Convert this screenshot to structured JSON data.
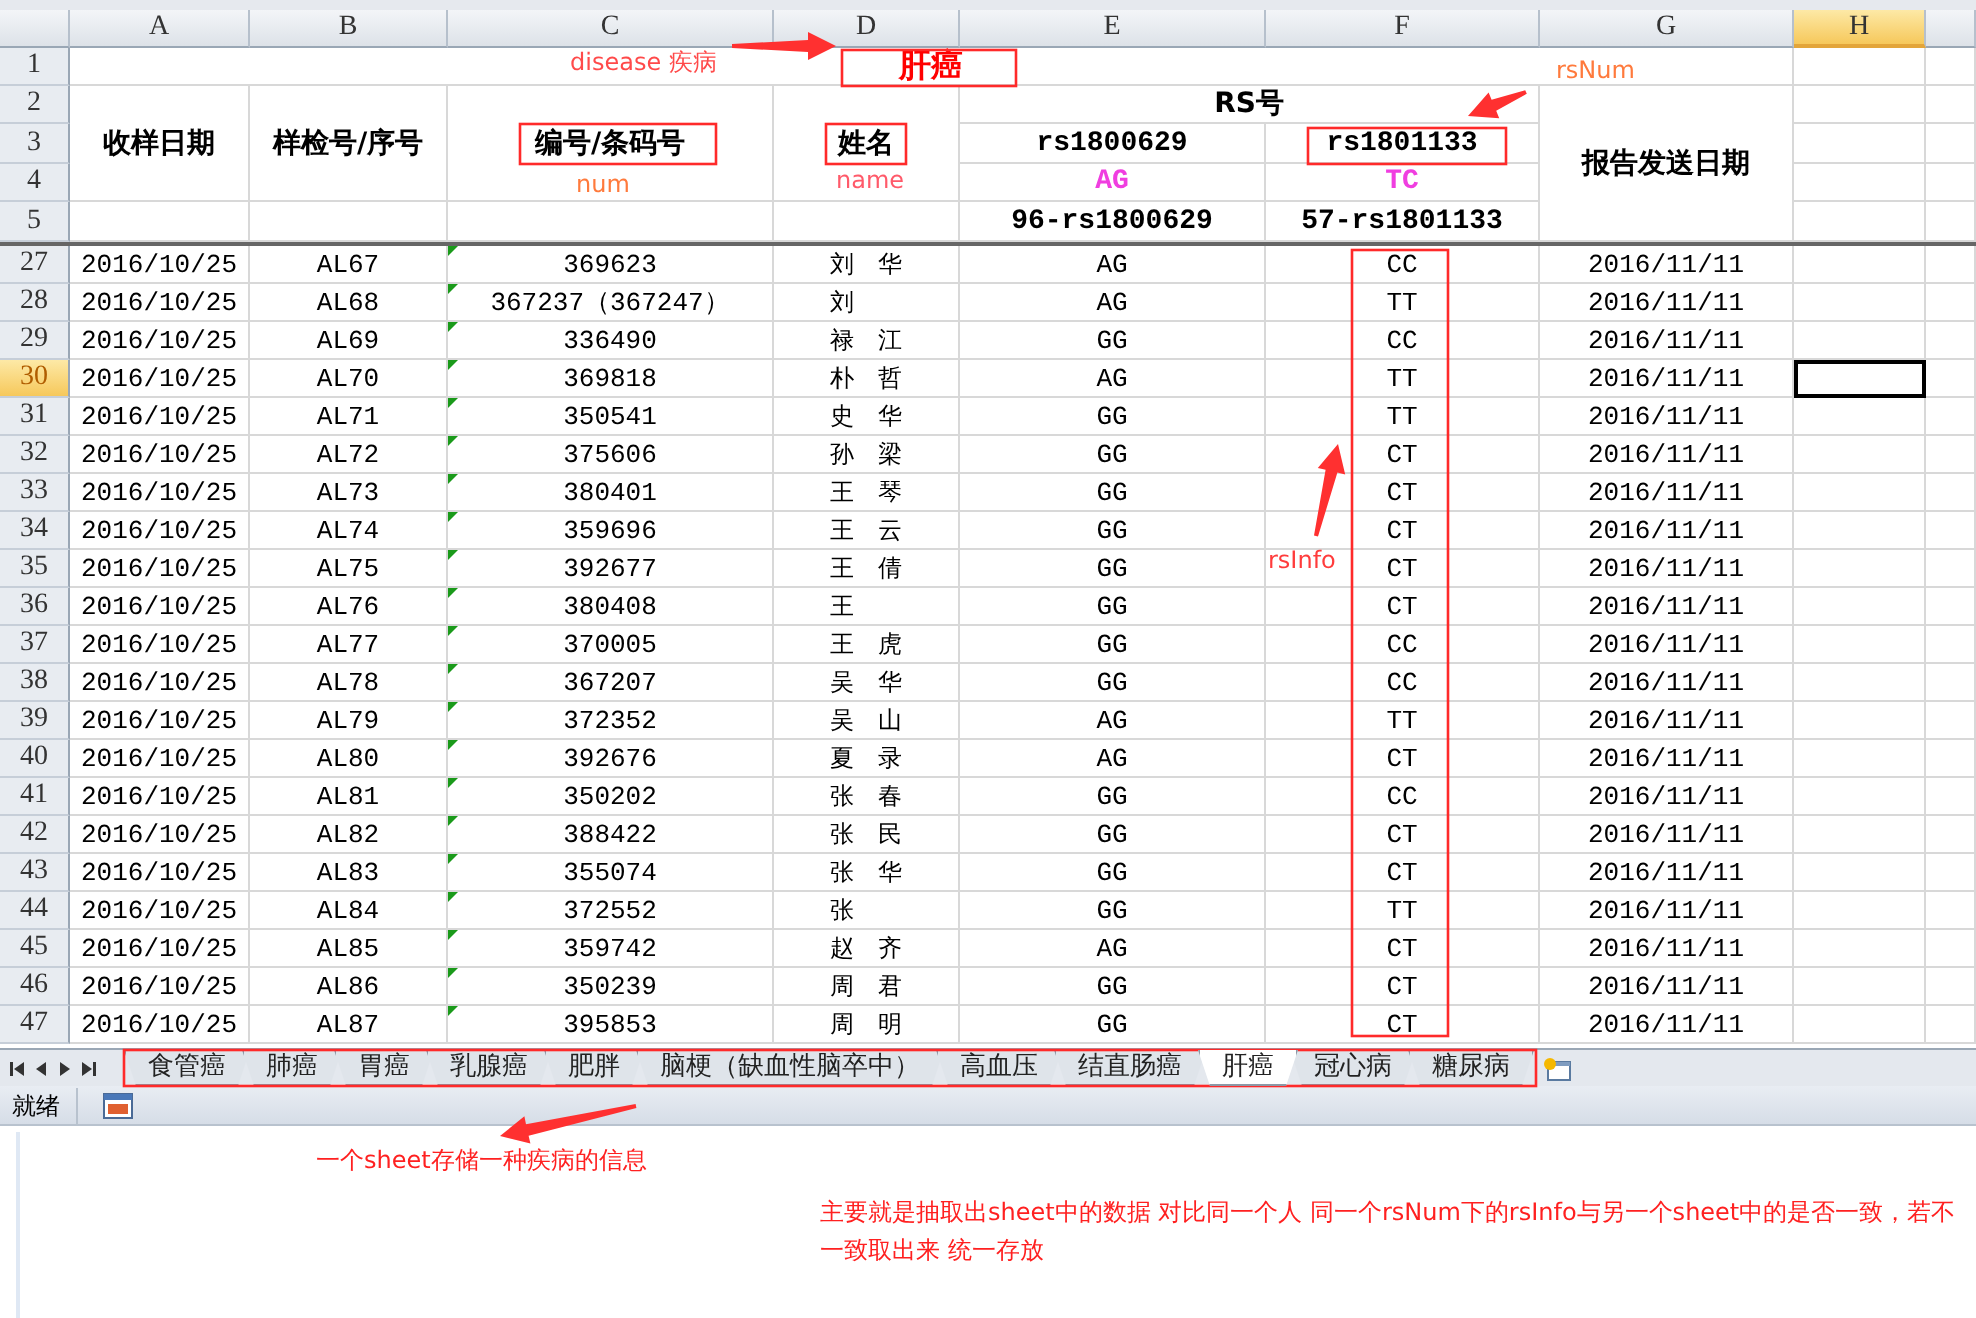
{
  "columns": [
    {
      "label": "A",
      "selected": false
    },
    {
      "label": "B",
      "selected": false
    },
    {
      "label": "C",
      "selected": false
    },
    {
      "label": "D",
      "selected": false
    },
    {
      "label": "E",
      "selected": false
    },
    {
      "label": "F",
      "selected": false
    },
    {
      "label": "G",
      "selected": false
    },
    {
      "label": "H",
      "selected": true
    }
  ],
  "header_rows": [
    "1",
    "2",
    "3",
    "4",
    "5"
  ],
  "header": {
    "disease": "肝癌",
    "date": "收样日期",
    "sample": "样检号/序号",
    "num": "编号/条码号",
    "name": "姓名",
    "rs": "RS号",
    "report": "报告发送日期",
    "snps": [
      {
        "id": "rs1800629",
        "allele": "AG",
        "code": "96-rs1800629"
      },
      {
        "id": "rs1801133",
        "allele": "TC",
        "code": "57-rs1801133"
      }
    ]
  },
  "rows": [
    {
      "number": "27",
      "selected": false,
      "cells": [
        "2016/10/25",
        "AL67",
        "369623",
        "刘　华",
        "AG",
        "CC",
        "2016/11/11"
      ]
    },
    {
      "number": "28",
      "selected": false,
      "cells": [
        "2016/10/25",
        "AL68",
        "367237（367247）",
        "刘",
        "AG",
        "TT",
        "2016/11/11"
      ]
    },
    {
      "number": "29",
      "selected": false,
      "cells": [
        "2016/10/25",
        "AL69",
        "336490",
        "禄　江",
        "GG",
        "CC",
        "2016/11/11"
      ]
    },
    {
      "number": "30",
      "selected": true,
      "cells": [
        "2016/10/25",
        "AL70",
        "369818",
        "朴　哲",
        "AG",
        "TT",
        "2016/11/11"
      ]
    },
    {
      "number": "31",
      "selected": false,
      "cells": [
        "2016/10/25",
        "AL71",
        "350541",
        "史　华",
        "GG",
        "TT",
        "2016/11/11"
      ]
    },
    {
      "number": "32",
      "selected": false,
      "cells": [
        "2016/10/25",
        "AL72",
        "375606",
        "孙　梁",
        "GG",
        "CT",
        "2016/11/11"
      ]
    },
    {
      "number": "33",
      "selected": false,
      "cells": [
        "2016/10/25",
        "AL73",
        "380401",
        "王　琴",
        "GG",
        "CT",
        "2016/11/11"
      ]
    },
    {
      "number": "34",
      "selected": false,
      "cells": [
        "2016/10/25",
        "AL74",
        "359696",
        "王　云",
        "GG",
        "CT",
        "2016/11/11"
      ]
    },
    {
      "number": "35",
      "selected": false,
      "cells": [
        "2016/10/25",
        "AL75",
        "392677",
        "王　倩",
        "GG",
        "CT",
        "2016/11/11"
      ]
    },
    {
      "number": "36",
      "selected": false,
      "cells": [
        "2016/10/25",
        "AL76",
        "380408",
        "王",
        "GG",
        "CT",
        "2016/11/11"
      ]
    },
    {
      "number": "37",
      "selected": false,
      "cells": [
        "2016/10/25",
        "AL77",
        "370005",
        "王　虎",
        "GG",
        "CC",
        "2016/11/11"
      ]
    },
    {
      "number": "38",
      "selected": false,
      "cells": [
        "2016/10/25",
        "AL78",
        "367207",
        "吴　华",
        "GG",
        "CC",
        "2016/11/11"
      ]
    },
    {
      "number": "39",
      "selected": false,
      "cells": [
        "2016/10/25",
        "AL79",
        "372352",
        "吴　山",
        "AG",
        "TT",
        "2016/11/11"
      ]
    },
    {
      "number": "40",
      "selected": false,
      "cells": [
        "2016/10/25",
        "AL80",
        "392676",
        "夏　录",
        "AG",
        "CT",
        "2016/11/11"
      ]
    },
    {
      "number": "41",
      "selected": false,
      "cells": [
        "2016/10/25",
        "AL81",
        "350202",
        "张　春",
        "GG",
        "CC",
        "2016/11/11"
      ]
    },
    {
      "number": "42",
      "selected": false,
      "cells": [
        "2016/10/25",
        "AL82",
        "388422",
        "张　民",
        "GG",
        "CT",
        "2016/11/11"
      ]
    },
    {
      "number": "43",
      "selected": false,
      "cells": [
        "2016/10/25",
        "AL83",
        "355074",
        "张　华",
        "GG",
        "CT",
        "2016/11/11"
      ]
    },
    {
      "number": "44",
      "selected": false,
      "cells": [
        "2016/10/25",
        "AL84",
        "372552",
        "张",
        "GG",
        "TT",
        "2016/11/11"
      ]
    },
    {
      "number": "45",
      "selected": false,
      "cells": [
        "2016/10/25",
        "AL85",
        "359742",
        "赵　齐",
        "AG",
        "CT",
        "2016/11/11"
      ]
    },
    {
      "number": "46",
      "selected": false,
      "cells": [
        "2016/10/25",
        "AL86",
        "350239",
        "周　君",
        "GG",
        "CT",
        "2016/11/11"
      ]
    },
    {
      "number": "47",
      "selected": false,
      "cells": [
        "2016/10/25",
        "AL87",
        "395853",
        "周　明",
        "GG",
        "CT",
        "2016/11/11"
      ]
    }
  ],
  "sheet_tabs": [
    {
      "label": "食管癌",
      "selected": false
    },
    {
      "label": "肺癌",
      "selected": false
    },
    {
      "label": "胃癌",
      "selected": false
    },
    {
      "label": "乳腺癌",
      "selected": false
    },
    {
      "label": "肥胖",
      "selected": false
    },
    {
      "label": "脑梗（缺血性脑卒中）",
      "selected": false
    },
    {
      "label": "高血压",
      "selected": false
    },
    {
      "label": "结直肠癌",
      "selected": false
    },
    {
      "label": "肝癌",
      "selected": true
    },
    {
      "label": "冠心病",
      "selected": false
    },
    {
      "label": "糖尿病",
      "selected": false
    }
  ],
  "status_bar": {
    "text": "就绪"
  },
  "annotations": [
    {
      "text": "disease 疾病",
      "color": "#ff4a4a"
    },
    {
      "text": "num",
      "color": "#ff7a3c"
    },
    {
      "text": "name",
      "color": "#ff5a6a"
    },
    {
      "text": "rsNum",
      "color": "#ff7a3c"
    },
    {
      "text": "rsInfo",
      "color": "#ff3c3c"
    },
    {
      "text": "一个sheet存储一种疾病的信息",
      "color": "#ff2020"
    },
    {
      "text": "主要就是抽取出sheet中的数据  对比同一个人  同一个rsNum下的rsInfo与另一个sheet中的是否一致，若不一致取出来 统一存放",
      "color": "#ff2020"
    }
  ]
}
